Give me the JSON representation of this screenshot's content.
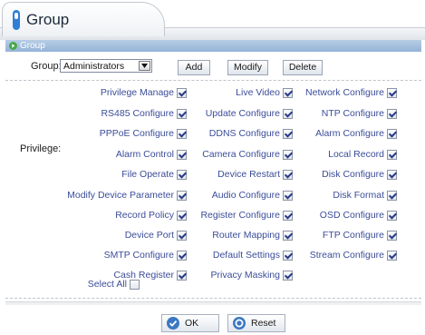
{
  "tab": {
    "title": "Group"
  },
  "section": {
    "title": "Group"
  },
  "group": {
    "label": "Group:",
    "selected": "Administrators",
    "buttons": {
      "add": "Add",
      "modify": "Modify",
      "delete": "Delete"
    }
  },
  "privilege": {
    "label": "Privilege:",
    "col1": [
      {
        "label": "Privilege Manage",
        "checked": true
      },
      {
        "label": "RS485 Configure",
        "checked": true
      },
      {
        "label": "PPPoE Configure",
        "checked": true
      },
      {
        "label": "Alarm Control",
        "checked": true
      },
      {
        "label": "File Operate",
        "checked": true
      },
      {
        "label": "Modify Device Parameter",
        "checked": true
      },
      {
        "label": "Record Policy",
        "checked": true
      },
      {
        "label": "Device Port",
        "checked": true
      },
      {
        "label": "SMTP Configure",
        "checked": true
      },
      {
        "label": "Cash Register",
        "checked": true
      }
    ],
    "col2": [
      {
        "label": "Live Video",
        "checked": true
      },
      {
        "label": "Update Configure",
        "checked": true
      },
      {
        "label": "DDNS Configure",
        "checked": true
      },
      {
        "label": "Camera Configure",
        "checked": true
      },
      {
        "label": "Device Restart",
        "checked": true
      },
      {
        "label": "Audio Configure",
        "checked": true
      },
      {
        "label": "Register Configure",
        "checked": true
      },
      {
        "label": "Router Mapping",
        "checked": true
      },
      {
        "label": "Default Settings",
        "checked": true
      },
      {
        "label": "Privacy Masking",
        "checked": true
      }
    ],
    "col3": [
      {
        "label": "Network Configure",
        "checked": true
      },
      {
        "label": "NTP Configure",
        "checked": true
      },
      {
        "label": "Alarm Configure",
        "checked": true
      },
      {
        "label": "Local Record",
        "checked": true
      },
      {
        "label": "Disk Configure",
        "checked": true
      },
      {
        "label": "Disk Format",
        "checked": true
      },
      {
        "label": "OSD Configure",
        "checked": true
      },
      {
        "label": "FTP Configure",
        "checked": true
      },
      {
        "label": "Stream Configure",
        "checked": true
      }
    ],
    "select_all": {
      "label": "Select All",
      "checked": false
    }
  },
  "footer": {
    "ok": "OK",
    "reset": "Reset"
  },
  "colors": {
    "accent": "#3b4d99",
    "section_bar": "#a6c0df",
    "ok_icon": "#3a78c3"
  }
}
